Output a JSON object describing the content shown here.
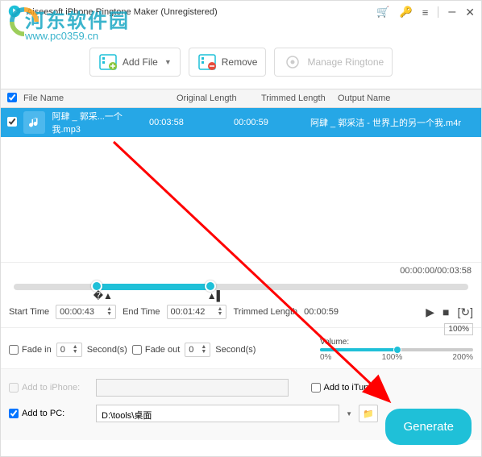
{
  "titlebar": {
    "title": "Aiseesoft iPhone Ringtone Maker (Unregistered)"
  },
  "watermark": {
    "line1": "河东软件园",
    "line2": "www.pc0359.cn"
  },
  "toolbar": {
    "add_file": "Add File",
    "remove": "Remove",
    "manage": "Manage Ringtone"
  },
  "table": {
    "headers": {
      "name": "File Name",
      "orig": "Original Length",
      "trim": "Trimmed Length",
      "out": "Output Name"
    },
    "row": {
      "name": "阿肆 _ 郭采...一个我.mp3",
      "orig": "00:03:58",
      "trim": "00:00:59",
      "out": "阿肆 _ 郭采洁 - 世界上的另一个我.m4r"
    }
  },
  "timeline": {
    "display": "00:00:00/00:03:58"
  },
  "times": {
    "start_label": "Start Time",
    "start_val": "00:00:43",
    "end_label": "End Time",
    "end_val": "00:01:42",
    "trimmed_label": "Trimmed Length",
    "trimmed_val": "00:00:59"
  },
  "fade": {
    "in_label": "Fade in",
    "in_val": "0",
    "out_label": "Fade out",
    "out_val": "0",
    "seconds": "Second(s)"
  },
  "volume": {
    "label": "Volume:",
    "value": "100%",
    "min": "0%",
    "mid": "100%",
    "max": "200%"
  },
  "output": {
    "iphone_label": "Add to iPhone:",
    "itunes_label": "Add to iTunes",
    "pc_label": "Add to PC:",
    "pc_path": "D:\\tools\\桌面"
  },
  "generate": "Generate"
}
